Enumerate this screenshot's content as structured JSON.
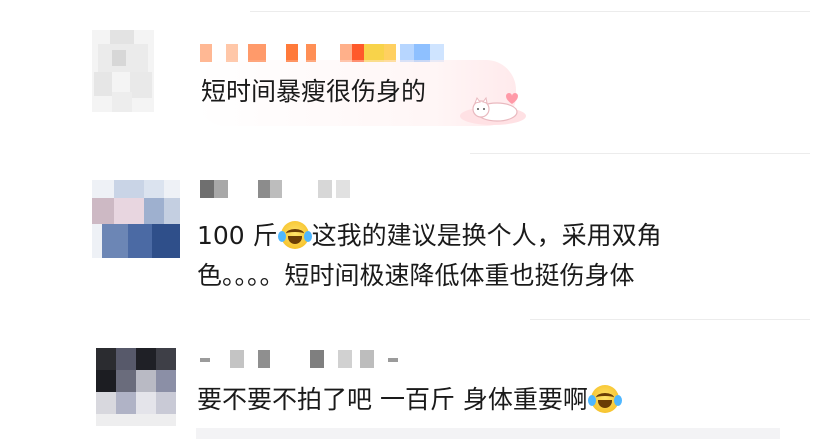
{
  "comments": [
    {
      "text": "短时间暴瘦很伤身的"
    },
    {
      "text_prefix": "100 斤",
      "emoji": "laugh-cry-emoji",
      "text_suffix": "这我的建议是换个人，采用双角",
      "text_line2": "色。。。。短时间极速降低体重也挺伤身体"
    },
    {
      "text": "要不要不拍了吧 一百斤 身体重要啊",
      "emoji": "laugh-cry-emoji"
    }
  ],
  "colors": {
    "text": "#1a1a1a",
    "divider": "#ececec",
    "emoji": "#f7c531"
  }
}
